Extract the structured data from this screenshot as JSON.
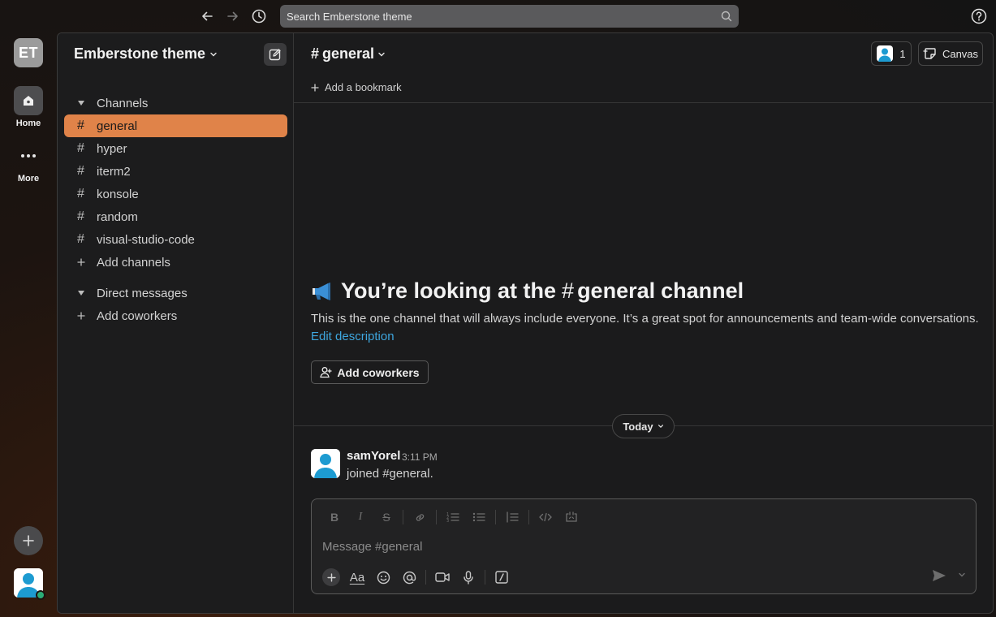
{
  "topbar": {
    "search_placeholder": "Search Emberstone theme",
    "icons": [
      "arrow-left-icon",
      "arrow-right-icon",
      "history-icon",
      "search-icon",
      "help-icon"
    ]
  },
  "rail": {
    "workspace_initials": "ET",
    "home_label": "Home",
    "more_label": "More"
  },
  "sidebar": {
    "workspace_name": "Emberstone theme",
    "channels_header": "Channels",
    "channels": [
      {
        "name": "general",
        "active": true
      },
      {
        "name": "hyper"
      },
      {
        "name": "iterm2"
      },
      {
        "name": "konsole"
      },
      {
        "name": "random"
      },
      {
        "name": "visual-studio-code"
      }
    ],
    "add_channels": "Add channels",
    "dm_header": "Direct messages",
    "add_coworkers": "Add coworkers"
  },
  "channel": {
    "name": "general",
    "member_count": "1",
    "canvas_label": "Canvas",
    "bookmark_label": "Add a bookmark",
    "intro_prefix": "You’re looking at the",
    "intro_channel": "general",
    "intro_suffix": "channel",
    "description": "This is the one channel that will always include everyone. It’s a great spot for announcements and team-wide conversations.",
    "edit_description": "Edit description",
    "add_coworkers_btn": "Add coworkers",
    "day_divider": "Today"
  },
  "messages": [
    {
      "author": "samYorel",
      "time": "3:11 PM",
      "text": "joined #general."
    }
  ],
  "composer": {
    "placeholder": "Message #general"
  },
  "colors": {
    "accent": "#e08349",
    "link": "#3ea6de",
    "online": "#2bac76"
  }
}
